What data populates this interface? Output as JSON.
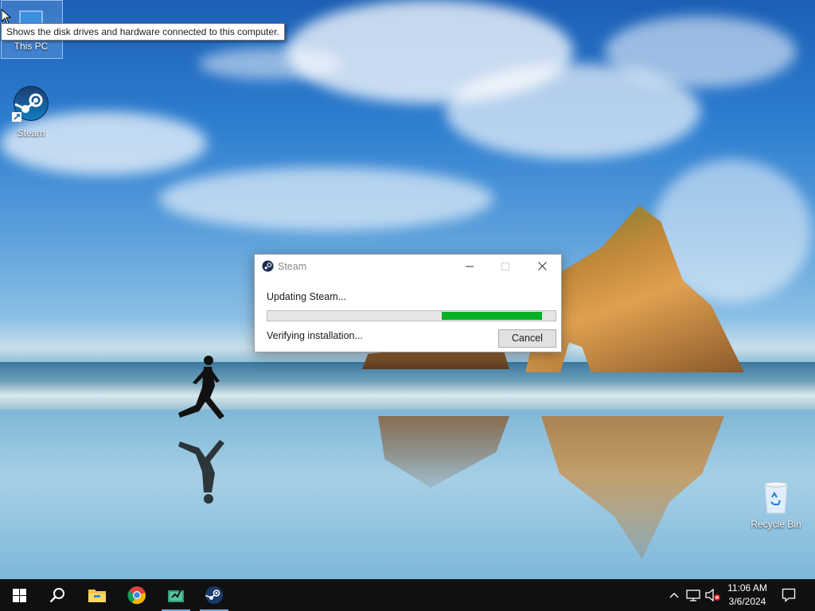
{
  "desktop": {
    "icons": [
      {
        "label": "This PC",
        "icon": "computer-icon"
      },
      {
        "label": "Steam",
        "icon": "steam-icon"
      },
      {
        "label": "Recycle Bin",
        "icon": "recycle-bin-icon"
      }
    ],
    "tooltip": "Shows the disk drives and hardware connected to this computer."
  },
  "dialog": {
    "title": "Steam",
    "status": "Updating Steam...",
    "progress": 0.35,
    "progress_color": "#06b025",
    "substatus": "Verifying installation...",
    "cancel_label": "Cancel"
  },
  "taskbar": {
    "items": [
      "windows-start-icon",
      "search-icon",
      "file-explorer-icon",
      "chrome-icon",
      "app-icon",
      "steam-icon"
    ],
    "tray": [
      "chevron-up-icon",
      "network-icon",
      "volume-muted-icon"
    ],
    "time": "11:06 AM",
    "date": "3/6/2024",
    "notification_icon": "action-center-icon"
  }
}
